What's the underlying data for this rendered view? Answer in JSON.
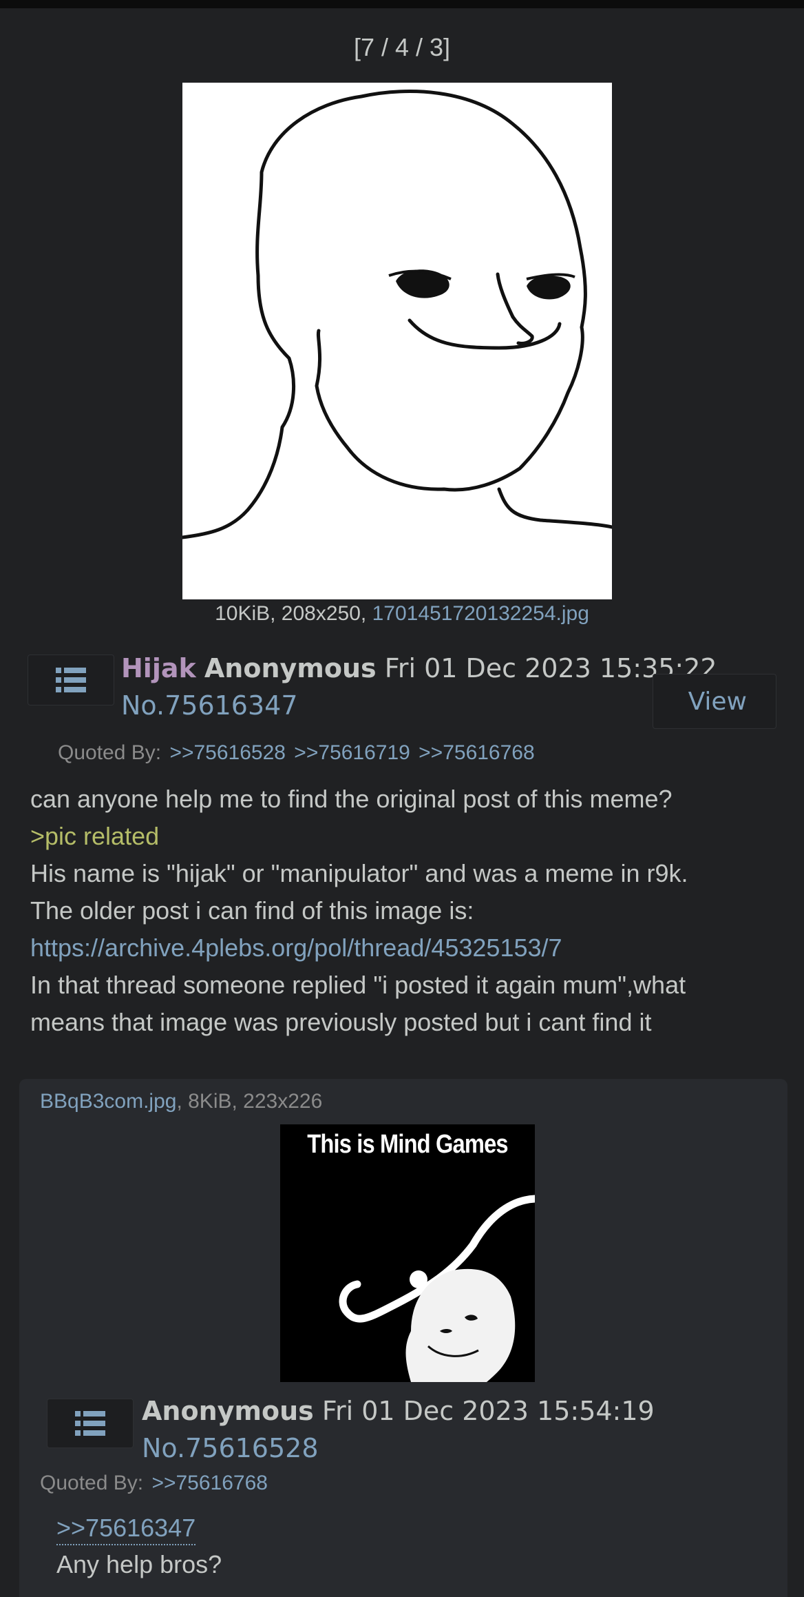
{
  "page_indicator": "[7 / 4 / 3]",
  "op": {
    "file": {
      "size_dims": "10KiB, 208x250, ",
      "filename": "1701451720132254.jpg"
    },
    "subject": "Hijak",
    "name": "Anonymous",
    "date": "Fri 01 Dec 2023 15:35:22",
    "post_no": "No.75616347",
    "view_label": "View",
    "quoted_by_label": "Quoted By:",
    "quoted_by": [
      ">>75616528",
      ">>75616719",
      ">>75616768"
    ],
    "body": {
      "line1": "can anyone help me to find the original post of this meme?",
      "greentext": ">pic related",
      "line3": "His name is \"hijak\" or \"manipulator\" and was a meme in r9k.",
      "line4": "The older post i can find of this image is:",
      "link": "https://archive.4plebs.org/pol/thread/45325153/7",
      "line6": "In that thread someone replied \"i posted it again mum\",what",
      "line7": "means that image was previously posted but i cant find it"
    }
  },
  "reply": {
    "file": {
      "filename": "BBqB3com.jpg",
      "size_dims": ", 8KiB, 223x226"
    },
    "image_caption": "This is Mind Games",
    "name": "Anonymous",
    "date": "Fri 01 Dec 2023 15:54:19",
    "post_no": "No.75616528",
    "quoted_by_label": "Quoted By:",
    "quoted_by": [
      ">>75616768"
    ],
    "quote": ">>75616347",
    "text": "Any help bros?"
  },
  "icons": {
    "menu": "list-icon"
  },
  "colors": {
    "background": "#202123",
    "reply_background": "#282a2e",
    "link": "#81a2be",
    "subject": "#b294bb",
    "greentext": "#b5bd68",
    "text": "#c5c8c6"
  }
}
